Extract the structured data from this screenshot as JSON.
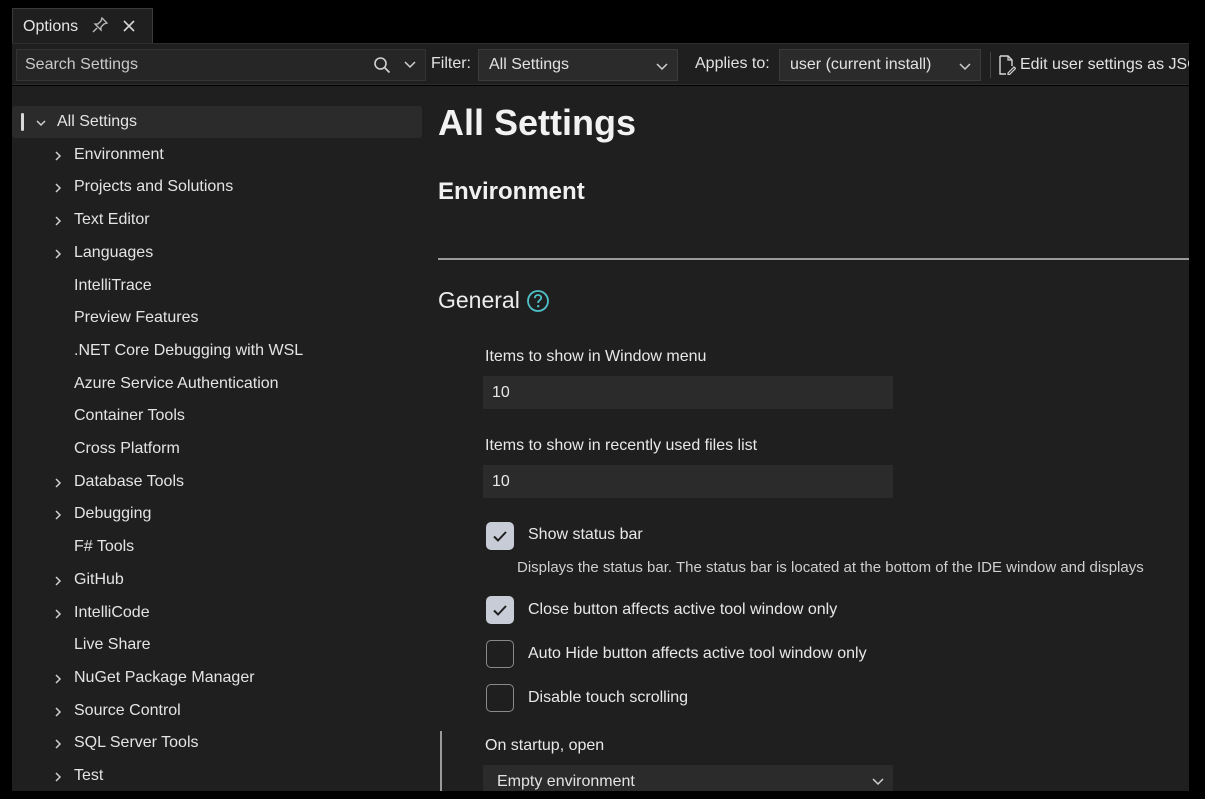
{
  "tab": {
    "title": "Options",
    "pin_icon": "pin-icon",
    "close_icon": "close-icon"
  },
  "toolbar": {
    "search_placeholder": "Search Settings",
    "filter_label": "Filter:",
    "filter_value": "All Settings",
    "applies_label": "Applies to:",
    "applies_value": "user (current install)",
    "edit_json_label": "Edit user settings as JSON"
  },
  "tree": {
    "items": [
      {
        "label": "All Settings",
        "expandable": true,
        "expanded": true,
        "selected": true
      },
      {
        "label": "Environment",
        "expandable": true
      },
      {
        "label": "Projects and Solutions",
        "expandable": true
      },
      {
        "label": "Text Editor",
        "expandable": true
      },
      {
        "label": "Languages",
        "expandable": true
      },
      {
        "label": "IntelliTrace",
        "expandable": false
      },
      {
        "label": "Preview Features",
        "expandable": false
      },
      {
        "label": ".NET Core Debugging with WSL",
        "expandable": false
      },
      {
        "label": "Azure Service Authentication",
        "expandable": false
      },
      {
        "label": "Container Tools",
        "expandable": false
      },
      {
        "label": "Cross Platform",
        "expandable": false
      },
      {
        "label": "Database Tools",
        "expandable": true
      },
      {
        "label": "Debugging",
        "expandable": true
      },
      {
        "label": "F# Tools",
        "expandable": false
      },
      {
        "label": "GitHub",
        "expandable": true
      },
      {
        "label": "IntelliCode",
        "expandable": true
      },
      {
        "label": "Live Share",
        "expandable": false
      },
      {
        "label": "NuGet Package Manager",
        "expandable": true
      },
      {
        "label": "Source Control",
        "expandable": true
      },
      {
        "label": "SQL Server Tools",
        "expandable": true
      },
      {
        "label": "Test",
        "expandable": true
      }
    ]
  },
  "content": {
    "page_title": "All Settings",
    "section_title": "Environment",
    "group_title": "General",
    "window_menu_label": "Items to show in Window menu",
    "window_menu_value": "10",
    "recent_files_label": "Items to show in recently used files list",
    "recent_files_value": "10",
    "checkboxes": [
      {
        "label": "Show status bar",
        "checked": true
      },
      {
        "label": "Close button affects active tool window only",
        "checked": true
      },
      {
        "label": "Auto Hide button affects active tool window only",
        "checked": false
      },
      {
        "label": "Disable touch scrolling",
        "checked": false
      }
    ],
    "status_bar_desc": "Displays the status bar. The status bar is located at the bottom of the IDE window and displays",
    "startup_label": "On startup, open",
    "startup_value": "Empty environment"
  },
  "colors": {
    "panel": "#1f1f1f",
    "input": "#2b2b2b",
    "checkbox_checked": "#c8ccd6",
    "help_icon": "#4fc1c9"
  }
}
